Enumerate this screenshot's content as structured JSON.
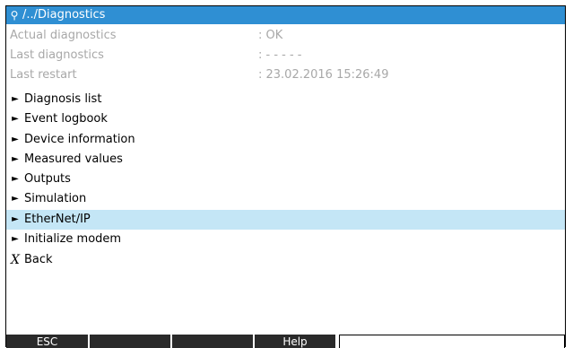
{
  "header": {
    "icon": "key-icon",
    "icon_glyph": "⚲",
    "title": "/../Diagnostics"
  },
  "info": [
    {
      "label": "Actual diagnostics",
      "value": ": OK"
    },
    {
      "label": "Last diagnostics",
      "value": ": - - - - -"
    },
    {
      "label": "Last restart",
      "value": ": 23.02.2016 15:26:49"
    }
  ],
  "menu": [
    {
      "label": "Diagnosis list",
      "arrow": "►"
    },
    {
      "label": "Event logbook",
      "arrow": "►"
    },
    {
      "label": "Device information",
      "arrow": "►"
    },
    {
      "label": "Measured values",
      "arrow": "►"
    },
    {
      "label": "Outputs",
      "arrow": "►"
    },
    {
      "label": "Simulation",
      "arrow": "►"
    },
    {
      "label": "EtherNet/IP",
      "arrow": "►",
      "selected": true
    },
    {
      "label": "Initialize modem",
      "arrow": "►"
    }
  ],
  "back": {
    "glyph": "X",
    "label": "Back"
  },
  "softkeys": [
    "ESC",
    "",
    "",
    "Help",
    ""
  ],
  "colors": {
    "title_bg": "#2f8fd3",
    "selected_bg": "#c4e6f6",
    "softkey_bg": "#2a2a2a",
    "disabled_text": "#a8a8a8"
  }
}
